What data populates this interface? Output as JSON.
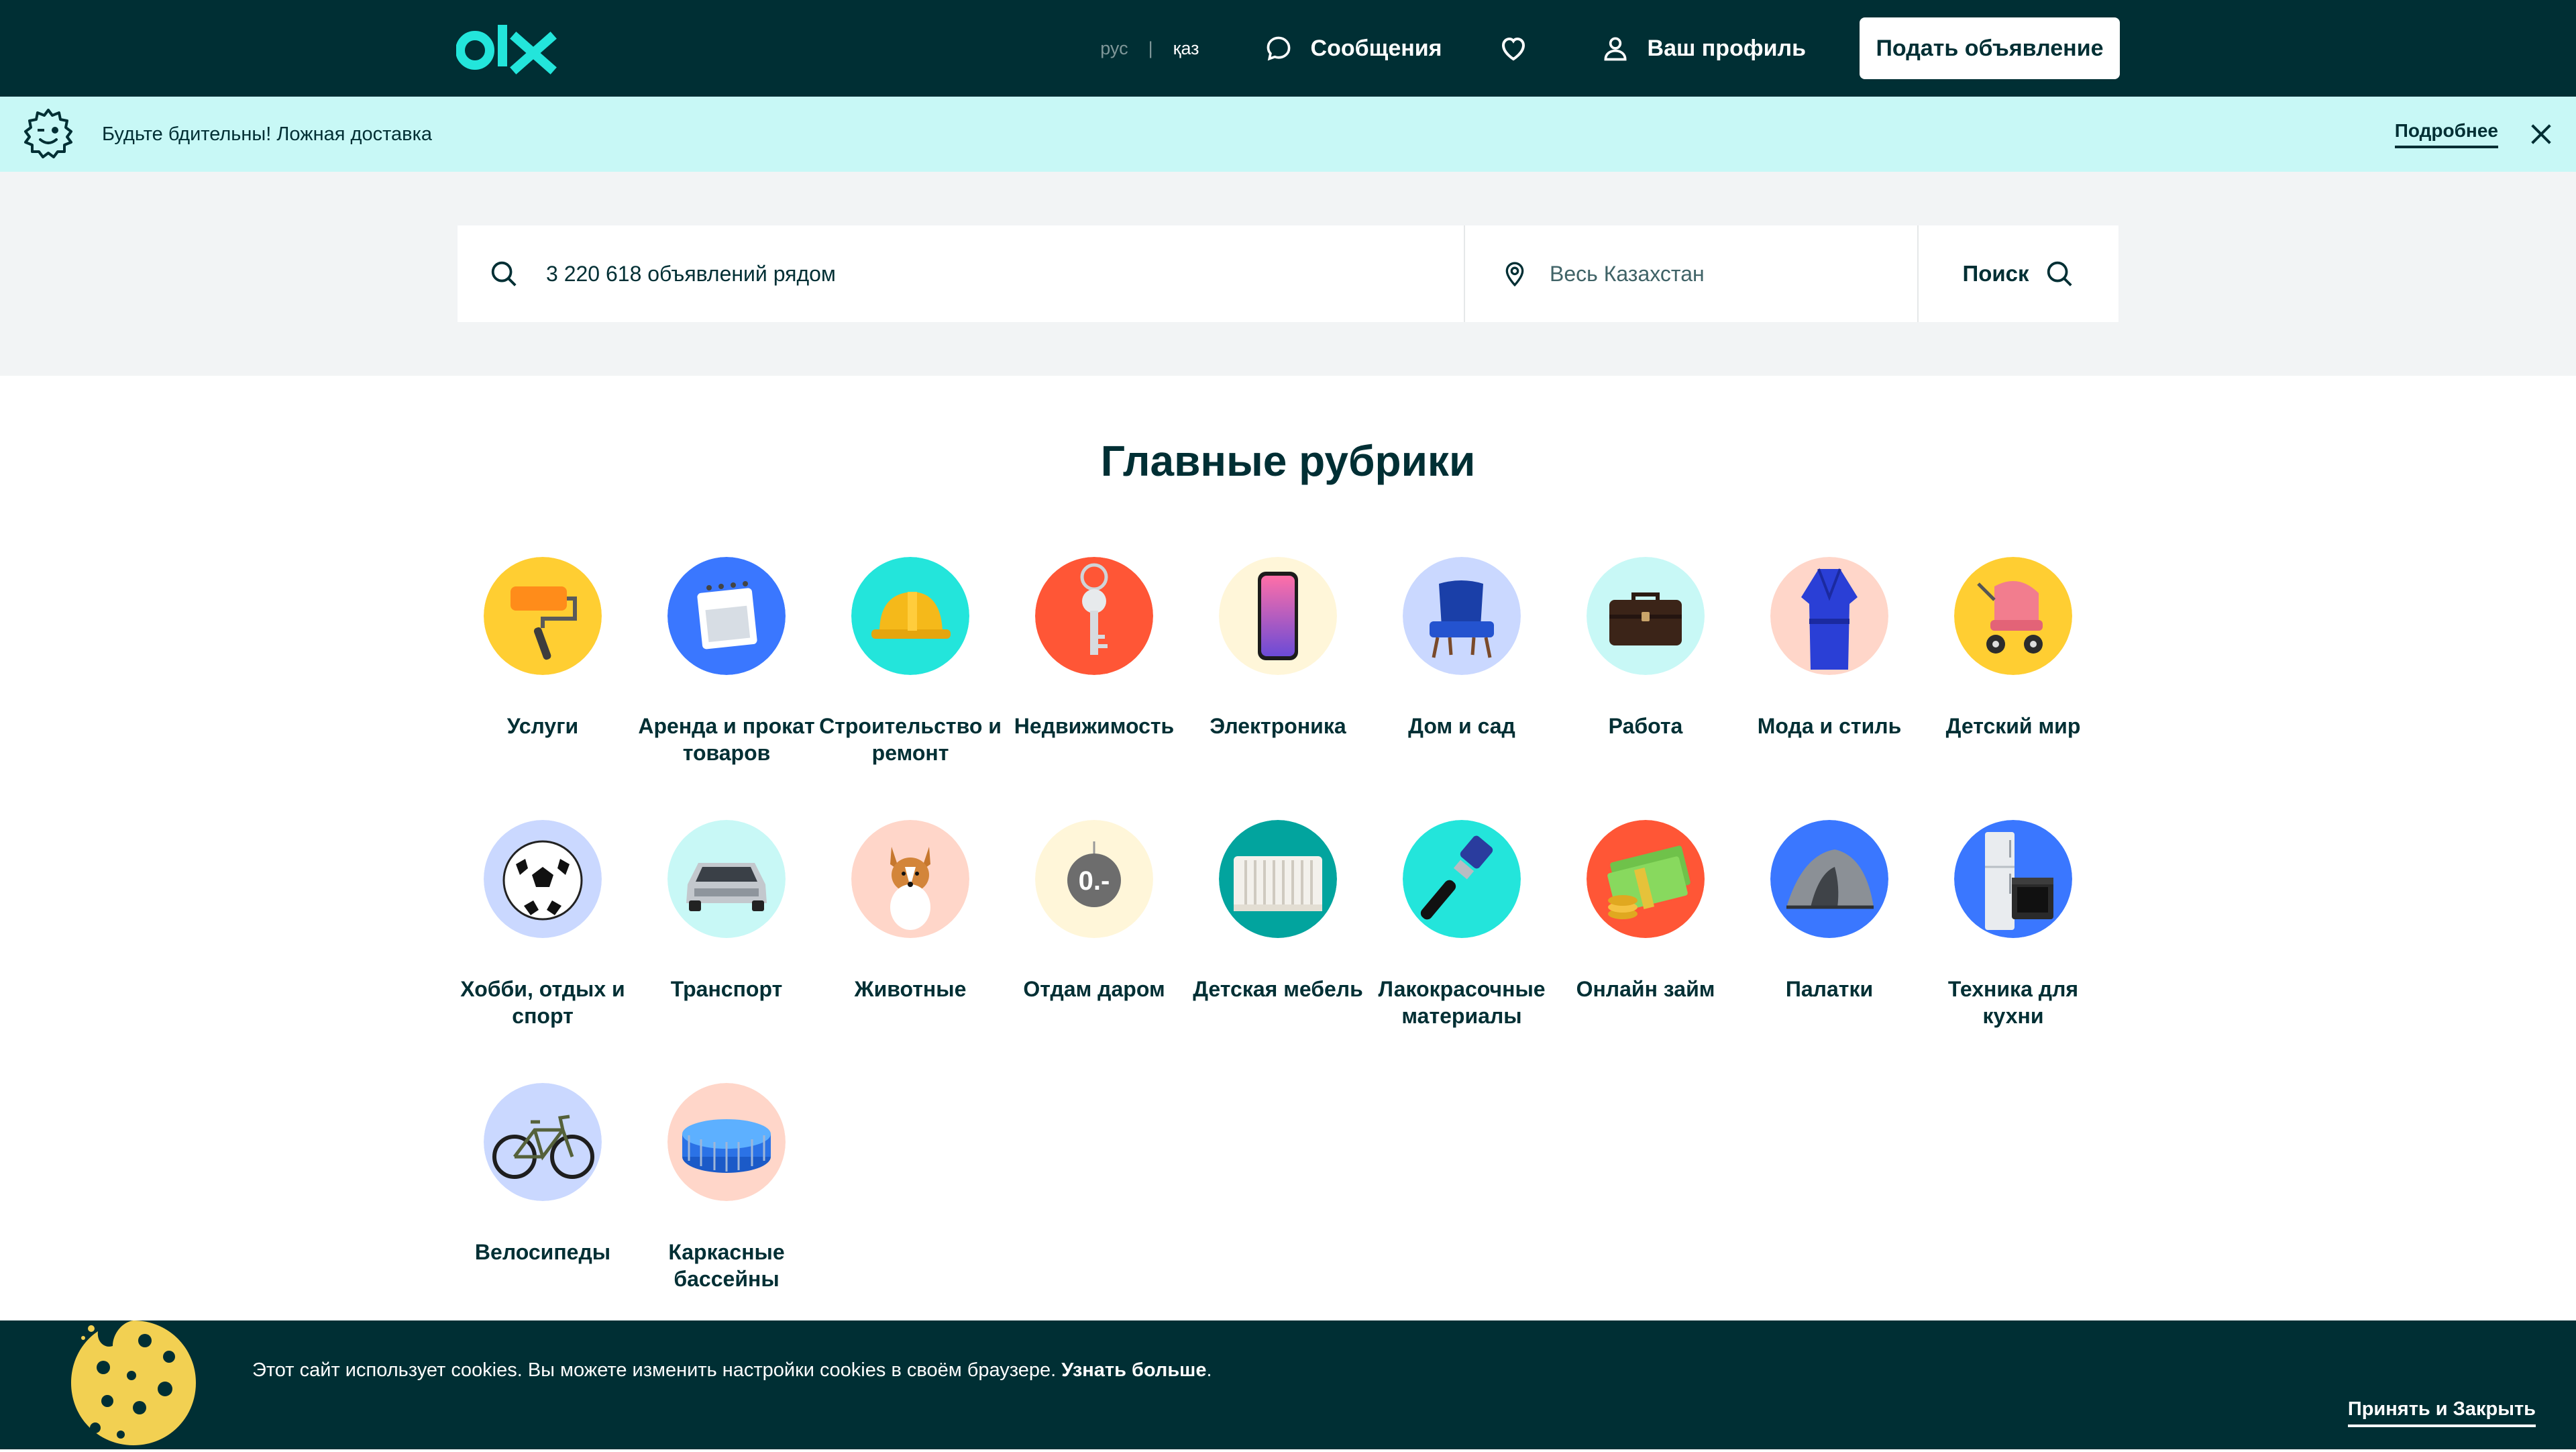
{
  "header": {
    "lang_ru": "рус",
    "lang_kz": "қаз",
    "messages": "Сообщения",
    "profile": "Ваш профиль",
    "post_ad": "Подать объявление"
  },
  "banner": {
    "text": "Будьте бдительны! Ложная доставка",
    "more": "Подробнее"
  },
  "search": {
    "query_placeholder": "3 220 618 объявлений рядом",
    "location_placeholder": "Весь Казахстан",
    "button": "Поиск"
  },
  "categories": {
    "title": "Главные рубрики",
    "items": [
      {
        "label": "Услуги",
        "icon": "paint-roller-icon",
        "bg": "#ffce32"
      },
      {
        "label": "Аренда и прокат товаров",
        "icon": "calendar-icon",
        "bg": "#3a77ff"
      },
      {
        "label": "Строительство и ремонт",
        "icon": "hard-hat-icon",
        "bg": "#23e5db"
      },
      {
        "label": "Недвижимость",
        "icon": "key-icon",
        "bg": "#ff5636"
      },
      {
        "label": "Электроника",
        "icon": "smartphone-icon",
        "bg": "#fff6d9"
      },
      {
        "label": "Дом и сад",
        "icon": "armchair-icon",
        "bg": "#cad8ff"
      },
      {
        "label": "Работа",
        "icon": "briefcase-icon",
        "bg": "#c8f8f6"
      },
      {
        "label": "Мода и стиль",
        "icon": "robe-icon",
        "bg": "#ffd6c9"
      },
      {
        "label": "Детский мир",
        "icon": "stroller-icon",
        "bg": "#ffce32"
      },
      {
        "label": "Хобби, отдых и спорт",
        "icon": "soccer-ball-icon",
        "bg": "#cad8ff"
      },
      {
        "label": "Транспорт",
        "icon": "car-icon",
        "bg": "#c8f8f6"
      },
      {
        "label": "Животные",
        "icon": "dog-icon",
        "bg": "#ffd6c9"
      },
      {
        "label": "Отдам даром",
        "icon": "free-coin-icon",
        "bg": "#fff6d9"
      },
      {
        "label": "Детская мебель",
        "icon": "crib-icon",
        "bg": "#02a49e"
      },
      {
        "label": "Лакокрасочные материалы",
        "icon": "paintbrush-icon",
        "bg": "#23e5db"
      },
      {
        "label": "Онлайн займ",
        "icon": "money-icon",
        "bg": "#ff5636"
      },
      {
        "label": "Палатки",
        "icon": "tent-icon",
        "bg": "#3a77ff"
      },
      {
        "label": "Техника для кухни",
        "icon": "fridge-icon",
        "bg": "#3a77ff"
      },
      {
        "label": "Велосипеды",
        "icon": "bicycle-icon",
        "bg": "#cad8ff"
      },
      {
        "label": "Каркасные бассейны",
        "icon": "pool-icon",
        "bg": "#ffd6c9"
      }
    ]
  },
  "cookie": {
    "text": "Этот сайт использует cookies. Вы можете изменить настройки cookies в своём браузере.",
    "more": "Узнать больше",
    "period": ".",
    "accept": "Принять и Закрыть"
  },
  "colors": {
    "brand_dark": "#002f34",
    "banner_bg": "#c8f8f6",
    "logo_accent": "#23e5db"
  }
}
